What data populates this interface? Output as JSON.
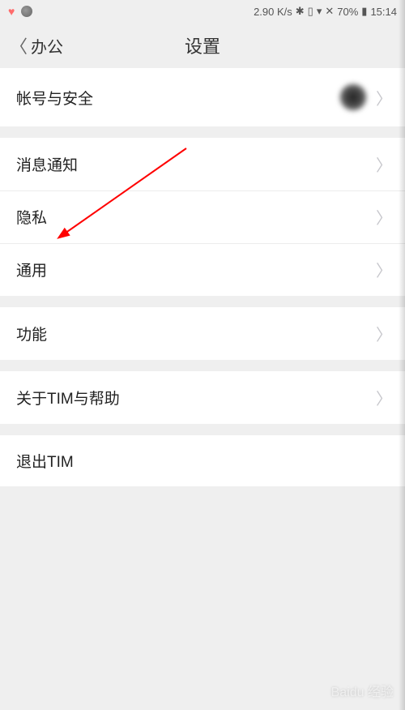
{
  "status": {
    "speed": "2.90 K/s",
    "battery": "70%",
    "time": "15:14"
  },
  "nav": {
    "back_label": "办公",
    "title": "设置"
  },
  "groups": [
    {
      "items": [
        {
          "label": "帐号与安全",
          "has_avatar": true,
          "has_chevron": true
        }
      ]
    },
    {
      "items": [
        {
          "label": "消息通知",
          "has_chevron": true
        },
        {
          "label": "隐私",
          "has_chevron": true
        },
        {
          "label": "通用",
          "has_chevron": true
        }
      ]
    },
    {
      "items": [
        {
          "label": "功能",
          "has_chevron": true
        }
      ]
    },
    {
      "items": [
        {
          "label": "关于TIM与帮助",
          "has_chevron": true
        }
      ]
    },
    {
      "items": [
        {
          "label": "退出TIM",
          "has_chevron": false
        }
      ]
    }
  ],
  "watermark": "Baidu 经验"
}
